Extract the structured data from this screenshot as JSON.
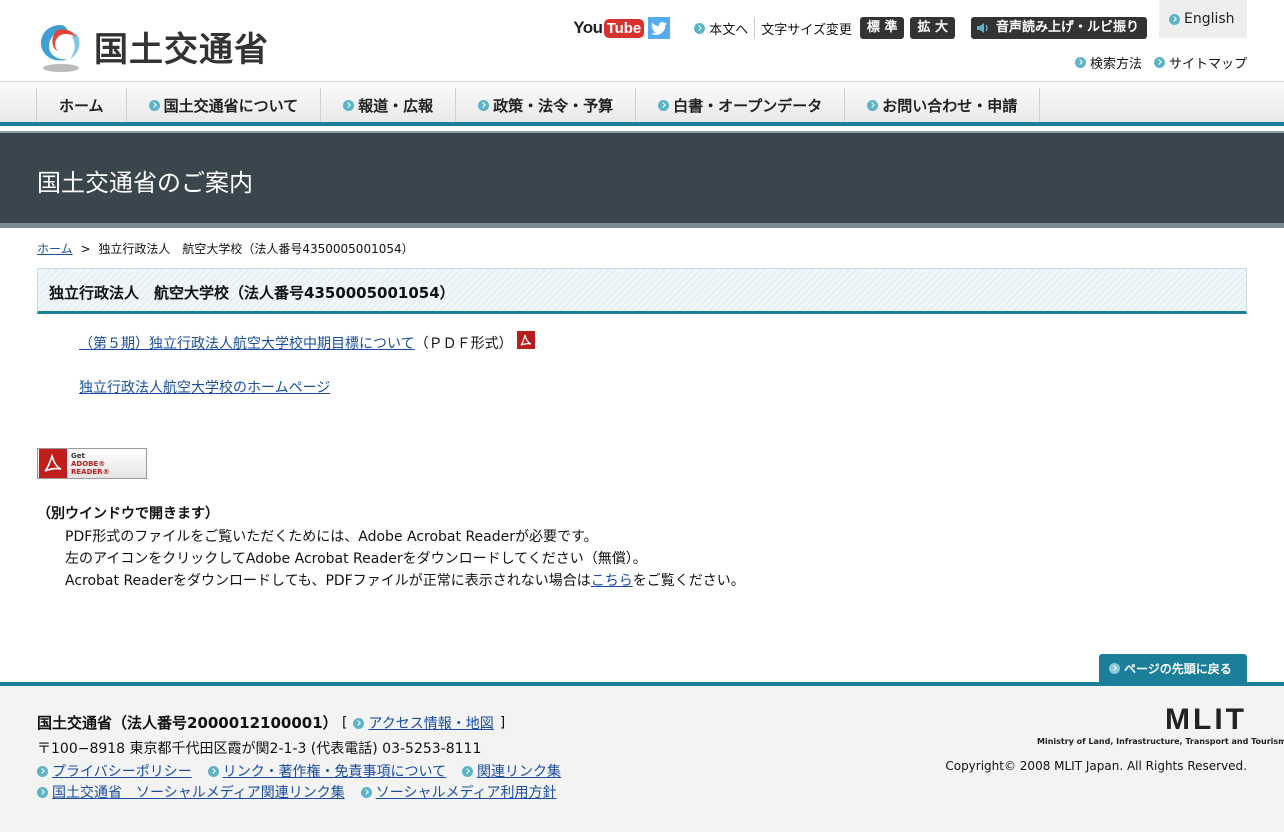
{
  "header": {
    "logo_text": "国土交通省",
    "youtube_you": "You",
    "youtube_tube": "Tube",
    "skip_to_content": "本文へ",
    "font_size_label": "文字サイズ変更",
    "font_standard": "標 準",
    "font_large": "拡 大",
    "voice_reading": "音声読み上げ・ルビ振り",
    "english": "English",
    "search_method": "検索方法",
    "sitemap": "サイトマップ"
  },
  "nav": {
    "items": [
      {
        "label": "ホーム"
      },
      {
        "label": "国土交通省について"
      },
      {
        "label": "報道・広報"
      },
      {
        "label": "政策・法令・予算"
      },
      {
        "label": "白書・オープンデータ"
      },
      {
        "label": "お問い合わせ・申請"
      }
    ]
  },
  "banner": {
    "title": "国土交通省のご案内"
  },
  "breadcrumb": {
    "home": "ホーム",
    "separator": ">",
    "current": "独立行政法人　航空大学校（法人番号4350005001054）"
  },
  "main": {
    "heading": "独立行政法人　航空大学校（法人番号4350005001054）",
    "link1": "（第５期）独立行政法人航空大学校中期目標について",
    "link1_suffix": "（ＰＤＦ形式）",
    "link2": "独立行政法人航空大学校のホームページ",
    "adobe_get": "Get",
    "adobe_reader": "ADOBE® READER®",
    "note_title": "（別ウインドウで開きます）",
    "note_line1": "PDF形式のファイルをご覧いただくためには、Adobe Acrobat Readerが必要です。",
    "note_line2": "左のアイコンをクリックしてAdobe Acrobat Readerをダウンロードしてください（無償）。",
    "note_line3_pre": "Acrobat Readerをダウンロードしても、PDFファイルが正常に表示されない場合は",
    "note_line3_link": "こちら",
    "note_line3_post": "をご覧ください。"
  },
  "pagetop": {
    "label": "ページの先頭に戻る"
  },
  "footer": {
    "title": "国土交通省（法人番号2000012100001）",
    "bracket_open": "[",
    "access": "アクセス情報・地図",
    "bracket_close": "]",
    "address": "〒100−8918 東京都千代田区霞が関2-1-3 (代表電話) 03-5253-8111",
    "links_row1": [
      "プライバシーポリシー",
      "リンク・著作権・免責事項について",
      "関連リンク集"
    ],
    "links_row2": [
      "国土交通省　ソーシャルメディア関連リンク集",
      "ソーシャルメディア利用方針"
    ],
    "mlit_logo": "MLIT",
    "mlit_subtitle": "Ministry of Land, Infrastructure, Transport and Tourism",
    "copyright": "Copyright© 2008 MLIT Japan. All Rights Reserved."
  },
  "colors": {
    "accent": "#1b7f99",
    "banner_bg": "#3a464d",
    "link": "#1a4ea0"
  }
}
